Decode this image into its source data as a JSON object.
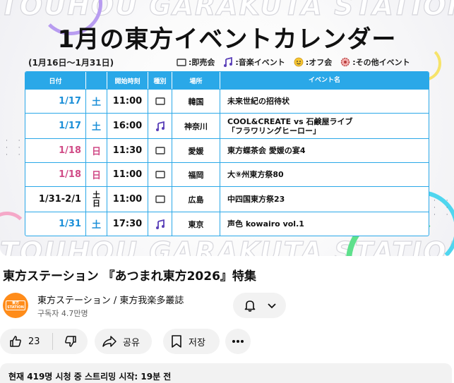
{
  "thumbnail": {
    "watermark": "TOUHOU GARAKUTA STATION",
    "title": "1月の東方イベントカレンダー",
    "period": "(1月16日〜1月31日)",
    "legend": [
      {
        "icon": "book-icon",
        "label": ":即売会"
      },
      {
        "icon": "music-note-icon",
        "label": ":音楽イベント"
      },
      {
        "icon": "smiley-icon",
        "label": ":オフ会"
      },
      {
        "icon": "badge-icon",
        "label": ":その他イベント"
      }
    ],
    "table": {
      "headers": {
        "date": "日付",
        "time": "開始時刻",
        "type": "種別",
        "place": "場所",
        "event": "イベント名"
      },
      "rows": [
        {
          "date": "1/17",
          "dow": "土",
          "time": "11:00",
          "type": "book-icon",
          "place": "韓国",
          "event": "未来世紀の招待状",
          "color": "#1b8fd8"
        },
        {
          "date": "1/17",
          "dow": "土",
          "time": "16:00",
          "type": "music-note-icon",
          "place": "神奈川",
          "event": "COOL&CREATE vs 石鹸屋ライブ",
          "event2": "「フラワリングヒーロー」",
          "color": "#1b8fd8"
        },
        {
          "date": "1/18",
          "dow": "日",
          "time": "11:30",
          "type": "book-icon",
          "place": "愛媛",
          "event": "東方蝶茶会 愛媛の宴4",
          "color": "#d04a86"
        },
        {
          "date": "1/18",
          "dow": "日",
          "time": "11:00",
          "type": "book-icon",
          "place": "福岡",
          "event": "大⑨州東方祭80",
          "color": "#d04a86"
        },
        {
          "date": "1/31-2/1",
          "dow": "土",
          "dow2": "日",
          "time": "11:00",
          "type": "book-icon",
          "place": "広島",
          "event": "中四国東方祭23",
          "color": "#111111"
        },
        {
          "date": "1/31",
          "dow": "土",
          "time": "17:30",
          "type": "music-note-icon",
          "place": "東京",
          "event": "声色 kowairo vol.1",
          "color": "#1b8fd8"
        }
      ]
    }
  },
  "video": {
    "title": "東方ステーション 『あつまれ東方2026』特集"
  },
  "channel": {
    "name": "東方ステーション / 東方我楽多叢誌",
    "subscribers": "구독자 4.7만명",
    "avatar_text": "東方 STATION",
    "avatar_color": "#ff8c1a"
  },
  "actions": {
    "like_count": "23",
    "share_label": "공유",
    "save_label": "저장"
  },
  "description": {
    "meta": "현재 419명 시청 중  스트리밍 시작: 19분 전"
  },
  "colors": {
    "accent_blue": "#2aa8e8",
    "weekday_blue": "#1b8fd8",
    "sunday_pink": "#d04a86",
    "button_bg": "#f2f2f2"
  }
}
